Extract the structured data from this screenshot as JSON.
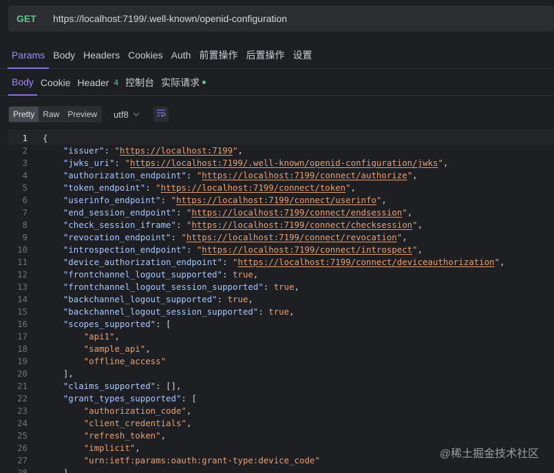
{
  "request": {
    "method": "GET",
    "url": "https://localhost:7199/.well-known/openid-configuration"
  },
  "request_tabs": [
    "Params",
    "Body",
    "Headers",
    "Cookies",
    "Auth",
    "前置操作",
    "后置操作",
    "设置"
  ],
  "response_tabs": {
    "body": "Body",
    "cookie": "Cookie",
    "header": "Header",
    "header_count": "4",
    "console": "控制台",
    "actual": "实际请求"
  },
  "view": {
    "pretty": "Pretty",
    "raw": "Raw",
    "preview": "Preview",
    "encoding": "utf8"
  },
  "json_lines": [
    "{",
    "    \"issuer\": \"https://localhost:7199\",",
    "    \"jwks_uri\": \"https://localhost:7199/.well-known/openid-configuration/jwks\",",
    "    \"authorization_endpoint\": \"https://localhost:7199/connect/authorize\",",
    "    \"token_endpoint\": \"https://localhost:7199/connect/token\",",
    "    \"userinfo_endpoint\": \"https://localhost:7199/connect/userinfo\",",
    "    \"end_session_endpoint\": \"https://localhost:7199/connect/endsession\",",
    "    \"check_session_iframe\": \"https://localhost:7199/connect/checksession\",",
    "    \"revocation_endpoint\": \"https://localhost:7199/connect/revocation\",",
    "    \"introspection_endpoint\": \"https://localhost:7199/connect/introspect\",",
    "    \"device_authorization_endpoint\": \"https://localhost:7199/connect/deviceauthorization\",",
    "    \"frontchannel_logout_supported\": true,",
    "    \"frontchannel_logout_session_supported\": true,",
    "    \"backchannel_logout_supported\": true,",
    "    \"backchannel_logout_session_supported\": true,",
    "    \"scopes_supported\": [",
    "        \"api1\",",
    "        \"sample_api\",",
    "        \"offline_access\"",
    "    ],",
    "    \"claims_supported\": [],",
    "    \"grant_types_supported\": [",
    "        \"authorization_code\",",
    "        \"client_credentials\",",
    "        \"refresh_token\",",
    "        \"implicit\",",
    "        \"urn:ietf:params:oauth:grant-type:device_code\"",
    "    ],"
  ],
  "watermark": "@稀土掘金技术社区",
  "colors": {
    "accent": "#8b6ff0",
    "method": "#5fc98e",
    "key": "#a8c8ff",
    "string": "#e9a070"
  }
}
